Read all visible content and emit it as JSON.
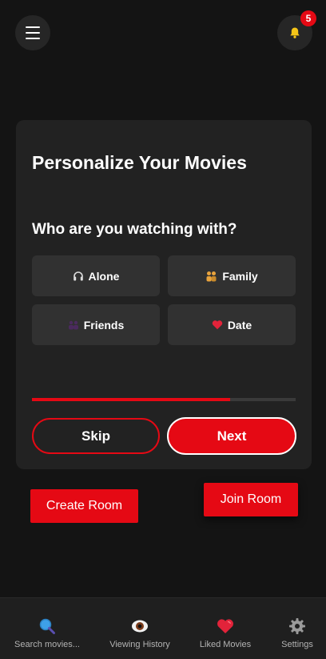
{
  "header": {
    "notification_count": "5"
  },
  "card": {
    "title": "Personalize Your Movies",
    "question": "Who are you watching with?",
    "options": [
      {
        "label": "Alone",
        "icon": "headphones-icon"
      },
      {
        "label": "Family",
        "icon": "family-icon"
      },
      {
        "label": "Friends",
        "icon": "friends-icon"
      },
      {
        "label": "Date",
        "icon": "heart-icon"
      }
    ],
    "progress": 0.75,
    "skip_label": "Skip",
    "next_label": "Next"
  },
  "rooms": {
    "create_label": "Create Room",
    "join_label": "Join Room"
  },
  "bottom_nav": [
    {
      "label": "Search movies...",
      "icon": "search-icon"
    },
    {
      "label": "Viewing History",
      "icon": "eye-icon"
    },
    {
      "label": "Liked Movies",
      "icon": "heart-icon"
    },
    {
      "label": "Settings",
      "icon": "gear-icon"
    }
  ],
  "colors": {
    "accent": "#e50914",
    "background": "#141414",
    "card": "#222222"
  }
}
